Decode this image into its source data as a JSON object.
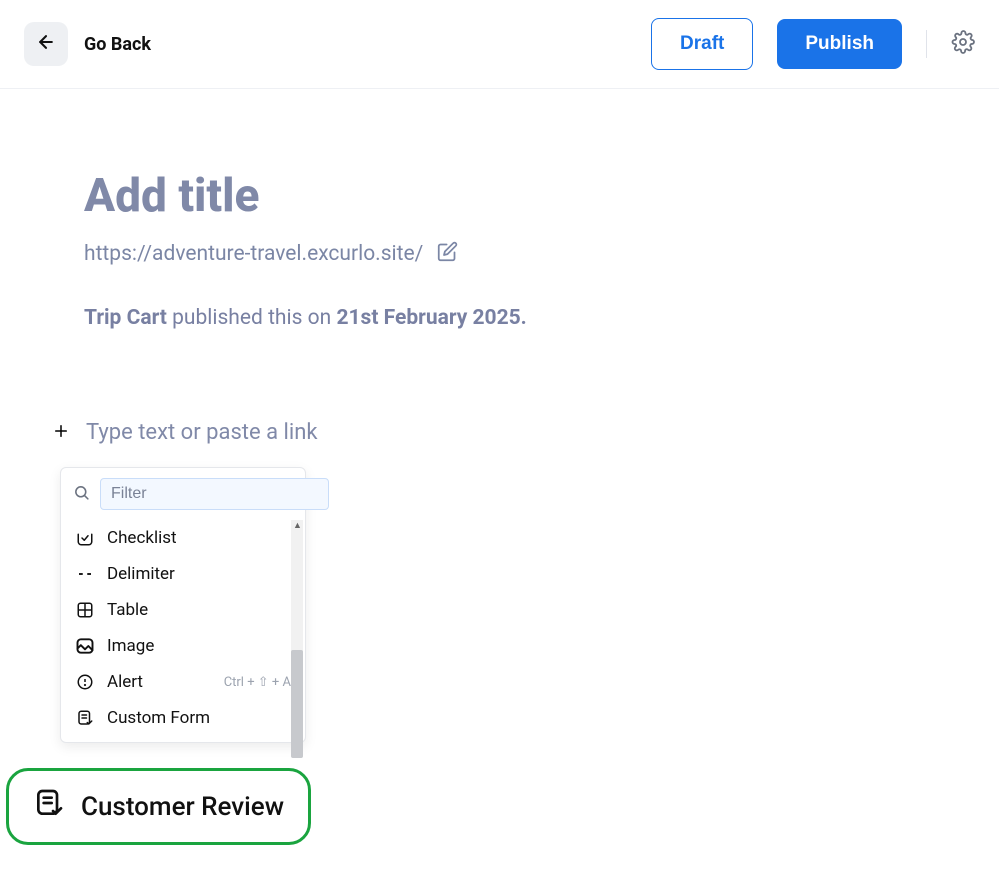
{
  "header": {
    "go_back": "Go Back",
    "draft": "Draft",
    "publish": "Publish"
  },
  "page": {
    "title_placeholder": "Add title",
    "url": "https://adventure-travel.excurlo.site/",
    "meta_author": "Trip Cart",
    "meta_middle": " published this on ",
    "meta_date": "21st February 2025.",
    "editor_placeholder": "Type text or paste a link"
  },
  "block_menu": {
    "filter_placeholder": "Filter",
    "items": [
      {
        "label": "Checklist",
        "shortcut": ""
      },
      {
        "label": "Delimiter",
        "shortcut": ""
      },
      {
        "label": "Table",
        "shortcut": ""
      },
      {
        "label": "Image",
        "shortcut": ""
      },
      {
        "label": "Alert",
        "shortcut": "Ctrl + ⇧ + A"
      },
      {
        "label": "Custom Form",
        "shortcut": ""
      }
    ]
  },
  "callout": {
    "label": "Customer Review"
  }
}
